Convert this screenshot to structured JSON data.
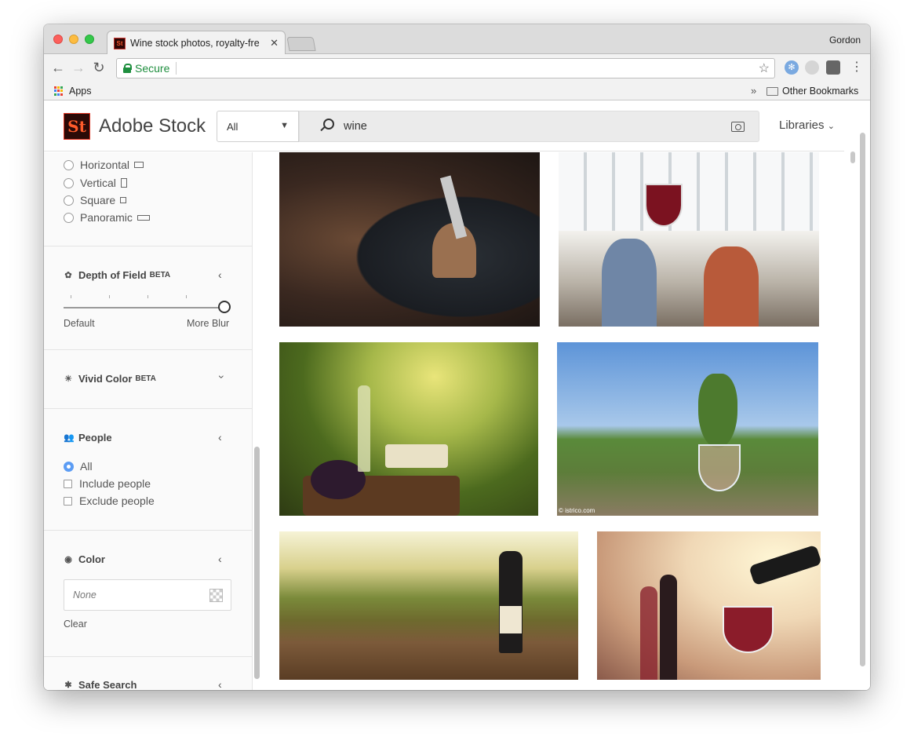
{
  "browser": {
    "tab_title": "Wine stock photos, royalty-fre",
    "profile_name": "Gordon",
    "secure_label": "Secure",
    "apps_label": "Apps",
    "other_bookmarks": "Other Bookmarks"
  },
  "header": {
    "logo_text": "St",
    "brand": "Adobe Stock",
    "filter_value": "All",
    "search_query": "wine",
    "libraries_label": "Libraries"
  },
  "sidebar": {
    "orientation": [
      "Horizontal",
      "Vertical",
      "Square",
      "Panoramic"
    ],
    "depth_of_field": {
      "title": "Depth of Field",
      "badge": "BETA",
      "min_label": "Default",
      "max_label": "More Blur",
      "value": 1.0
    },
    "vivid_color": {
      "title": "Vivid Color",
      "badge": "BETA"
    },
    "people": {
      "title": "People",
      "options": [
        "All",
        "Include people",
        "Exclude people"
      ],
      "selected": "All"
    },
    "color": {
      "title": "Color",
      "value": "None",
      "clear_label": "Clear"
    },
    "safe_search": {
      "title": "Safe Search"
    }
  },
  "results": {
    "watermark": "© istrico.com"
  },
  "colors": {
    "accent_blue": "#5b9cf4",
    "secure_green": "#1e8e3e",
    "brand_orange": "#ff5b2b"
  }
}
